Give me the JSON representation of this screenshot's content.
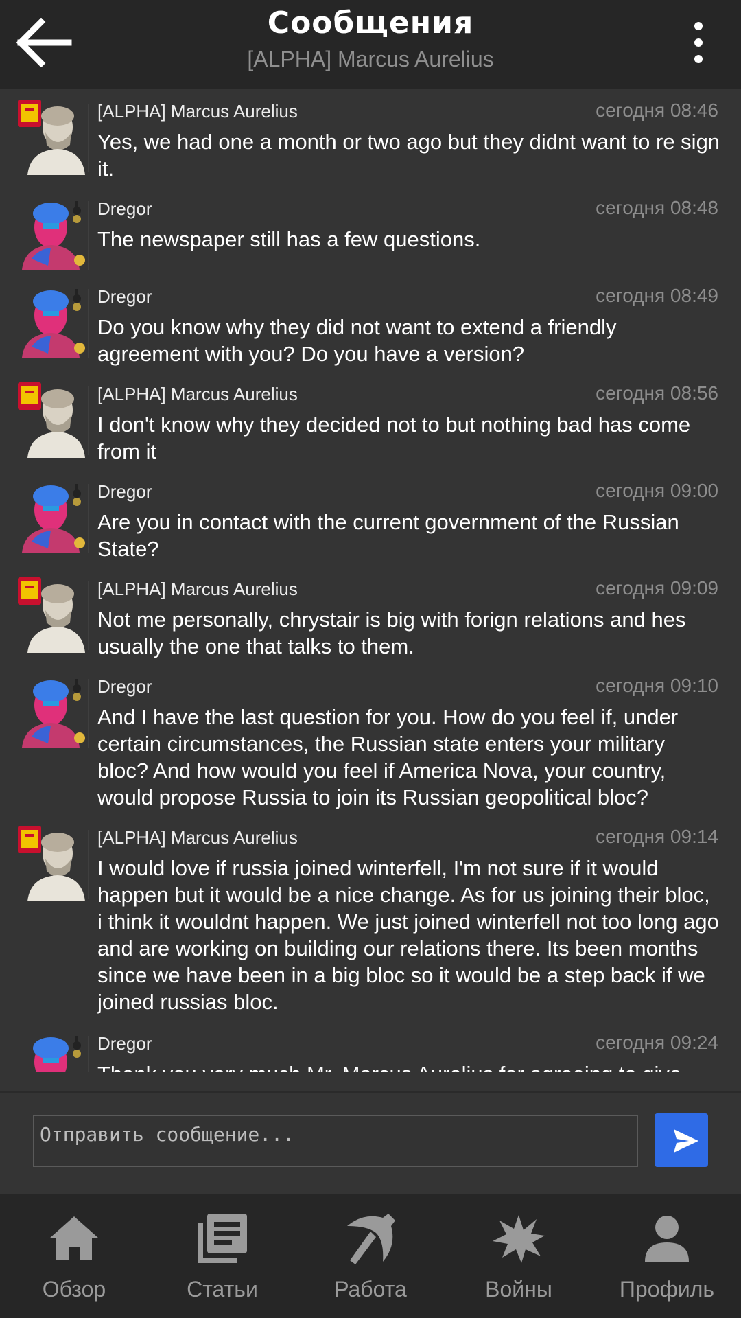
{
  "header": {
    "title": "Сообщения",
    "subtitle": "[ALPHA] Marcus Aurelius",
    "back_icon": "arrow-left-icon",
    "menu_icon": "more-vertical-icon"
  },
  "messages": [
    {
      "sender": "[ALPHA] Marcus Aurelius",
      "time": "сегодня 08:46",
      "text": "Yes, we had one a month or two ago but they didnt want to re sign it.",
      "avatar": "bust"
    },
    {
      "sender": "Dregor",
      "time": "сегодня 08:48",
      "text": "The newspaper still has a few questions.",
      "avatar": "pop"
    },
    {
      "sender": "Dregor",
      "time": "сегодня 08:49",
      "text": "Do you know why they did not want to extend a friendly agreement with you? Do you have a version?",
      "avatar": "pop"
    },
    {
      "sender": "[ALPHA] Marcus Aurelius",
      "time": "сегодня 08:56",
      "text": "I don't know why they decided not to but nothing bad has come from it",
      "avatar": "bust"
    },
    {
      "sender": "Dregor",
      "time": "сегодня 09:00",
      "text": "Are you in contact with the current government of the Russian State?",
      "avatar": "pop"
    },
    {
      "sender": "[ALPHA] Marcus Aurelius",
      "time": "сегодня 09:09",
      "text": "Not me personally, chrystair is big with forign relations and hes usually the one that talks to them.",
      "avatar": "bust"
    },
    {
      "sender": "Dregor",
      "time": "сегодня 09:10",
      "text": "And I have the last question for you. How do you feel if, under certain circumstances, the Russian state enters your military bloc? And how would you feel if America Nova, your country, would propose Russia to join its Russian geopolitical bloc?",
      "avatar": "pop"
    },
    {
      "sender": "[ALPHA] Marcus Aurelius",
      "time": "сегодня 09:14",
      "text": "I would love if russia joined winterfell, I'm not sure if it would happen but it would be a nice change. As for us joining their bloc, i think it wouldnt happen. We just joined winterfell not too long ago and are working on building our relations there. Its been months since we have been in a big bloc so it would be a step back if we joined russias bloc.",
      "avatar": "bust"
    },
    {
      "sender": "Dregor",
      "time": "сегодня 09:24",
      "text": "Thank you very much Mr. Marcus Aurelius for agreeing to give",
      "avatar": "pop"
    }
  ],
  "composer": {
    "placeholder": "Отправить сообщение...",
    "send_icon": "send-icon"
  },
  "nav": [
    {
      "label": "Обзор",
      "icon": "home-icon"
    },
    {
      "label": "Статьи",
      "icon": "articles-icon"
    },
    {
      "label": "Работа",
      "icon": "pickaxe-icon"
    },
    {
      "label": "Войны",
      "icon": "explosion-icon"
    },
    {
      "label": "Профиль",
      "icon": "profile-icon"
    }
  ],
  "colors": {
    "header_bg": "#262626",
    "body_bg": "#343434",
    "accent": "#2f6be6",
    "muted_text": "#8d8d8d"
  }
}
